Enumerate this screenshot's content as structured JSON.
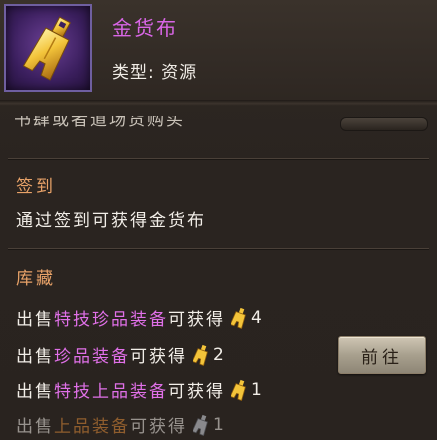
{
  "item": {
    "name": "金货布",
    "type_line": "类型: 资源",
    "icon": "gold-coin-spade-icon"
  },
  "clipped_text": "书肆或者道场货购买",
  "sections": {
    "signin": {
      "title": "签到",
      "text": "通过签到可获得金货布"
    },
    "storage": {
      "title": "库藏",
      "rows": [
        {
          "prefix": "出售",
          "highlight": "特技珍品装备",
          "highlight_color": "purple",
          "suffix": "可获得",
          "count": "4",
          "coin": "gold"
        },
        {
          "prefix": "出售",
          "highlight": "珍品装备",
          "highlight_color": "purple",
          "suffix": "可获得",
          "count": "2",
          "coin": "gold"
        },
        {
          "prefix": "出售",
          "highlight": "特技上品装备",
          "highlight_color": "purple",
          "suffix": "可获得",
          "count": "1",
          "coin": "gold"
        },
        {
          "prefix": "出售",
          "highlight": "上品装备",
          "highlight_color": "gold",
          "suffix": "可获得",
          "count": "1",
          "coin": "silver"
        }
      ]
    }
  },
  "buttons": {
    "goto": "前往"
  },
  "colors": {
    "item_name": "#d866e6",
    "section_title": "#e8a268",
    "highlight_purple": "#e070e8",
    "highlight_gold": "#e38e3a"
  }
}
